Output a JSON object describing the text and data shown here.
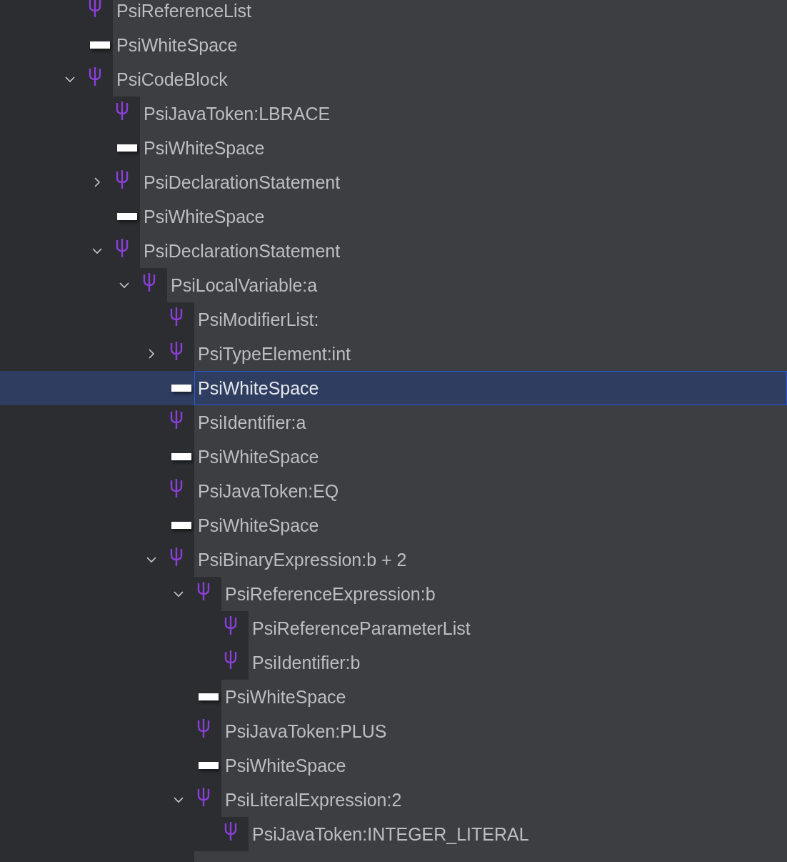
{
  "tree": [
    {
      "label": "PsiReferenceList",
      "kind": "element",
      "selected": false
    },
    {
      "label": "PsiWhiteSpace",
      "kind": "whitespace",
      "selected": false
    },
    {
      "label": "PsiCodeBlock",
      "kind": "element",
      "selected": false,
      "expanded": true,
      "children": [
        {
          "label": "PsiJavaToken:LBRACE",
          "kind": "element",
          "selected": false
        },
        {
          "label": "PsiWhiteSpace",
          "kind": "whitespace",
          "selected": false
        },
        {
          "label": "PsiDeclarationStatement",
          "kind": "element",
          "selected": false,
          "expanded": false
        },
        {
          "label": "PsiWhiteSpace",
          "kind": "whitespace",
          "selected": false
        },
        {
          "label": "PsiDeclarationStatement",
          "kind": "element",
          "selected": false,
          "expanded": true,
          "children": [
            {
              "label": "PsiLocalVariable:a",
              "kind": "element",
              "selected": false,
              "expanded": true,
              "children": [
                {
                  "label": "PsiModifierList:",
                  "kind": "element",
                  "selected": false
                },
                {
                  "label": "PsiTypeElement:int",
                  "kind": "element",
                  "selected": false,
                  "expanded": false
                },
                {
                  "label": "PsiWhiteSpace",
                  "kind": "whitespace",
                  "selected": true
                },
                {
                  "label": "PsiIdentifier:a",
                  "kind": "element",
                  "selected": false
                },
                {
                  "label": "PsiWhiteSpace",
                  "kind": "whitespace",
                  "selected": false
                },
                {
                  "label": "PsiJavaToken:EQ",
                  "kind": "element",
                  "selected": false
                },
                {
                  "label": "PsiWhiteSpace",
                  "kind": "whitespace",
                  "selected": false
                },
                {
                  "label": "PsiBinaryExpression:b + 2",
                  "kind": "element",
                  "selected": false,
                  "expanded": true,
                  "children": [
                    {
                      "label": "PsiReferenceExpression:b",
                      "kind": "element",
                      "selected": false,
                      "expanded": true,
                      "children": [
                        {
                          "label": "PsiReferenceParameterList",
                          "kind": "element",
                          "selected": false
                        },
                        {
                          "label": "PsiIdentifier:b",
                          "kind": "element",
                          "selected": false
                        }
                      ]
                    },
                    {
                      "label": "PsiWhiteSpace",
                      "kind": "whitespace",
                      "selected": false
                    },
                    {
                      "label": "PsiJavaToken:PLUS",
                      "kind": "element",
                      "selected": false
                    },
                    {
                      "label": "PsiWhiteSpace",
                      "kind": "whitespace",
                      "selected": false
                    },
                    {
                      "label": "PsiLiteralExpression:2",
                      "kind": "element",
                      "selected": false,
                      "expanded": true,
                      "children": [
                        {
                          "label": "PsiJavaToken:INTEGER_LITERAL",
                          "kind": "element",
                          "selected": false
                        }
                      ]
                    }
                  ]
                }
              ]
            }
          ]
        }
      ]
    }
  ]
}
